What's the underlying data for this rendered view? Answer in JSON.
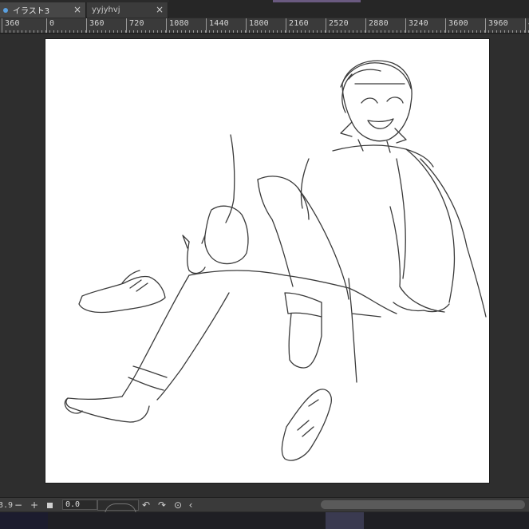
{
  "tabs": [
    {
      "label": "イラスト3",
      "active": true
    },
    {
      "label": "yyjyhvj",
      "active": false
    }
  ],
  "ruler": {
    "labels": [
      "360",
      "0",
      "360",
      "720",
      "1080",
      "1440",
      "1800",
      "2160",
      "2520",
      "2880",
      "3240",
      "3600",
      "3960",
      "4"
    ]
  },
  "status": {
    "zoom": "3.9",
    "minus": "−",
    "plus": "+",
    "angle": "0.0",
    "rotate_left": "↶",
    "rotate_right": "↷",
    "reset": "⊙",
    "scroll_left": "‹"
  },
  "icons": {
    "tab_close": "×"
  }
}
